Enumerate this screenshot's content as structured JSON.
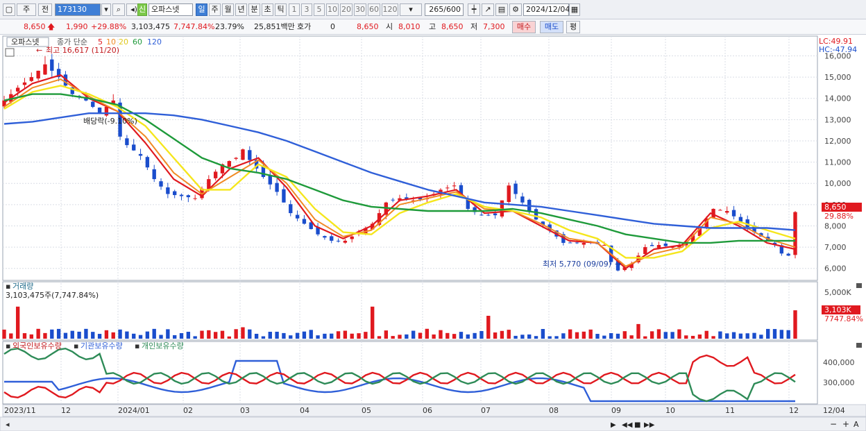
{
  "toolbar": {
    "period_label": "주",
    "prev_label": "전",
    "code_value": "173130",
    "sin_badge": "신",
    "stock_name": "오파스넷",
    "period_tabs": [
      "일",
      "주",
      "월",
      "년",
      "분",
      "초",
      "틱"
    ],
    "interval_tabs": [
      "1",
      "3",
      "5",
      "10",
      "20",
      "30",
      "60",
      "120"
    ],
    "count_display": "265/600",
    "date_value": "2024/12/04"
  },
  "quote": {
    "price": "8,650",
    "change": "1,990",
    "change_pct": "+29.88%",
    "volume": "3,103,475",
    "volume_pct": "7,747.84%",
    "turnover": "23.79%",
    "amount": "25,851백만",
    "hoga_label": "호가",
    "hoga_value": "0",
    "ask_price": "8,650",
    "open_label": "시",
    "open_value": "8,010",
    "high_label": "고",
    "high_value": "8,650",
    "low_label": "저",
    "low_value": "7,300",
    "buy_label": "매수",
    "sell_label": "매도",
    "eval_label": "평"
  },
  "colors": {
    "up": "#e0191f",
    "down": "#1a4dcc",
    "ma5": "#e0191f",
    "ma10": "#f08a24",
    "ma20": "#f5e61c",
    "ma60": "#1e9a3a",
    "ma120": "#2f5fd8",
    "foreign": "#e0191f",
    "institution": "#2f5fd8",
    "individual": "#2e8b57"
  },
  "main_panel": {
    "stock_label": "오파스넷",
    "legend_prefix": "종가 단순",
    "ma_periods": [
      "5",
      "10",
      "20",
      "60",
      "120"
    ],
    "high_annotation": "최고 16,617 (11/20)",
    "low_annotation": "최저 5,770 (09/09)",
    "dividend_annotation": "배당락(-9.10%)",
    "lc_label": "LC:49.91",
    "hc_label": "HC:-47.94",
    "price_tag": "8,650",
    "pct_tag": "29.88%",
    "y_ticks": [
      "16,000",
      "15,000",
      "14,000",
      "13,000",
      "12,000",
      "11,000",
      "10,000",
      "9,000",
      "8,000",
      "7,000",
      "6,000"
    ]
  },
  "volume_panel": {
    "title": "거래량",
    "value_label": "3,103,475주(7,747.84%)",
    "y_tick": "5,000K",
    "tag_value": "3,103K",
    "tag_pct": "7747.84%"
  },
  "investor_panel": {
    "legend": [
      "외국인보유수량",
      "기관보유수량",
      "개인보유수량"
    ],
    "y_ticks": [
      "400,000",
      "300,000"
    ]
  },
  "x_axis": [
    "2023/11",
    "12",
    "2024/01",
    "02",
    "03",
    "04",
    "05",
    "06",
    "07",
    "08",
    "09",
    "10",
    "11",
    "12",
    "12/04"
  ],
  "chart_data": {
    "type": "candlestick",
    "ylim": [
      5500,
      16800
    ],
    "close_path": [
      [
        0,
        13900
      ],
      [
        2,
        14500
      ],
      [
        4,
        15000
      ],
      [
        6,
        15600
      ],
      [
        8,
        15000
      ],
      [
        10,
        14200
      ],
      [
        12,
        13900
      ],
      [
        14,
        13300
      ],
      [
        16,
        13900
      ],
      [
        17,
        12200
      ],
      [
        18,
        11800
      ],
      [
        20,
        11300
      ],
      [
        22,
        10200
      ],
      [
        24,
        9500
      ],
      [
        26,
        9400
      ],
      [
        28,
        9300
      ],
      [
        30,
        10200
      ],
      [
        32,
        10900
      ],
      [
        34,
        11200
      ],
      [
        35,
        11600
      ],
      [
        36,
        11100
      ],
      [
        38,
        10300
      ],
      [
        40,
        9600
      ],
      [
        42,
        8600
      ],
      [
        44,
        8100
      ],
      [
        46,
        7600
      ],
      [
        48,
        7300
      ],
      [
        50,
        7300
      ],
      [
        52,
        7700
      ],
      [
        54,
        8100
      ],
      [
        56,
        9100
      ],
      [
        58,
        9300
      ],
      [
        60,
        9200
      ],
      [
        62,
        9300
      ],
      [
        64,
        9700
      ],
      [
        66,
        9900
      ],
      [
        68,
        8800
      ],
      [
        70,
        8500
      ],
      [
        72,
        8500
      ],
      [
        74,
        9900
      ],
      [
        76,
        9100
      ],
      [
        78,
        8300
      ],
      [
        80,
        7800
      ],
      [
        82,
        7200
      ],
      [
        84,
        7200
      ],
      [
        86,
        7200
      ],
      [
        88,
        7100
      ],
      [
        89,
        6300
      ],
      [
        90,
        5900
      ],
      [
        92,
        6200
      ],
      [
        94,
        7000
      ],
      [
        96,
        7100
      ],
      [
        98,
        7000
      ],
      [
        100,
        7200
      ],
      [
        102,
        7900
      ],
      [
        104,
        8800
      ],
      [
        106,
        8700
      ],
      [
        108,
        8200
      ],
      [
        110,
        7700
      ],
      [
        112,
        7300
      ],
      [
        113,
        7100
      ],
      [
        114,
        6700
      ],
      [
        115,
        6600
      ],
      [
        116,
        8650
      ]
    ],
    "high": {
      "value": 16617,
      "date": "11/20"
    },
    "low": {
      "value": 5770,
      "date": "09/09"
    },
    "ma_series": [
      {
        "name": "5",
        "values": [
          13800,
          14700,
          15100,
          14000,
          13400,
          11900,
          10200,
          9400,
          10700,
          11200,
          9800,
          8000,
          7400,
          8000,
          9200,
          9400,
          9700,
          8600,
          8700,
          8000,
          7300,
          7200,
          6000,
          6900,
          7100,
          8600,
          8000,
          7200,
          6900
        ]
      },
      {
        "name": "10",
        "values": [
          13600,
          14500,
          14900,
          14100,
          13400,
          12200,
          10500,
          9500,
          10300,
          11100,
          10000,
          8300,
          7500,
          7800,
          9000,
          9300,
          9600,
          8800,
          8700,
          8100,
          7400,
          7200,
          6100,
          6700,
          7000,
          8400,
          8100,
          7400,
          7000
        ]
      },
      {
        "name": "20",
        "values": [
          13500,
          14300,
          14600,
          14200,
          13600,
          12700,
          11200,
          9700,
          9700,
          10900,
          10300,
          8800,
          7700,
          7600,
          8600,
          9100,
          9500,
          8900,
          8700,
          8400,
          7800,
          7400,
          6500,
          6500,
          6800,
          7900,
          8200,
          7800,
          7400
        ]
      },
      {
        "name": "60",
        "values": [
          13900,
          14200,
          14200,
          14000,
          13700,
          13000,
          12100,
          11200,
          10700,
          10500,
          10200,
          9700,
          9200,
          8900,
          8800,
          8700,
          8700,
          8700,
          8800,
          8600,
          8300,
          8000,
          7600,
          7400,
          7200,
          7200,
          7300,
          7300,
          7300
        ]
      },
      {
        "name": "120",
        "values": [
          12800,
          12900,
          13100,
          13300,
          13300,
          13300,
          13200,
          13000,
          12700,
          12400,
          12000,
          11500,
          11000,
          10500,
          10100,
          9700,
          9400,
          9100,
          9000,
          8900,
          8700,
          8500,
          8300,
          8100,
          8000,
          7900,
          7900,
          7900,
          7800
        ]
      }
    ]
  }
}
